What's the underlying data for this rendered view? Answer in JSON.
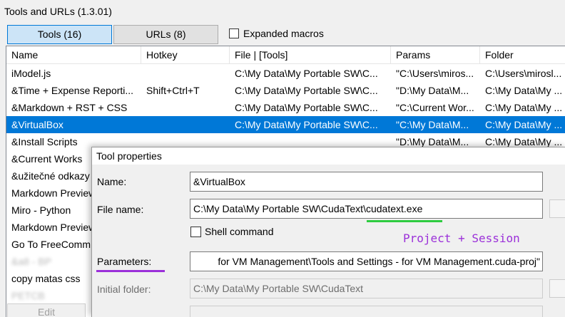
{
  "window": {
    "title": "Tools and URLs (1.3.01)"
  },
  "tabs": [
    {
      "label": "Tools (16)",
      "active": true
    },
    {
      "label": "URLs (8)",
      "active": false
    }
  ],
  "expanded_macros": {
    "label": "Expanded macros",
    "checked": false
  },
  "list": {
    "columns": [
      "Name",
      "Hotkey",
      "File | [Tools]",
      "Params",
      "Folder"
    ],
    "rows": [
      {
        "name": "iModel.js",
        "hotkey": "",
        "file": "C:\\My Data\\My Portable SW\\C...",
        "params": "\"C:\\Users\\miros...",
        "folder": "C:\\Users\\mirosl..."
      },
      {
        "name": "&Time + Expense Reporti...",
        "hotkey": "Shift+Ctrl+T",
        "file": "C:\\My Data\\My Portable SW\\C...",
        "params": "\"D:\\My Data\\M...",
        "folder": "C:\\My Data\\My ..."
      },
      {
        "name": "&Markdown + RST + CSS",
        "hotkey": "",
        "file": "C:\\My Data\\My Portable SW\\C...",
        "params": "\"C:\\Current Wor...",
        "folder": "C:\\My Data\\My ..."
      },
      {
        "name": "&VirtualBox",
        "hotkey": "",
        "file": "C:\\My Data\\My Portable SW\\C...",
        "params": "\"C:\\My Data\\M...",
        "folder": "C:\\My Data\\My ..."
      },
      {
        "name": "&Install Scripts",
        "hotkey": "",
        "file": "",
        "params": "\"D:\\My Data\\M...",
        "folder": "C:\\My Data\\My ..."
      },
      {
        "name": "&Current Works",
        "hotkey": "",
        "file": "",
        "params": "",
        "folder": ""
      },
      {
        "name": "&užitečné odkazy",
        "hotkey": "",
        "file": "",
        "params": "",
        "folder": ""
      },
      {
        "name": "Markdown Preview",
        "hotkey": "",
        "file": "",
        "params": "",
        "folder": ""
      },
      {
        "name": "Miro - Python",
        "hotkey": "",
        "file": "",
        "params": "",
        "folder": ""
      },
      {
        "name": "Markdown Preview",
        "hotkey": "",
        "file": "",
        "params": "",
        "folder": ""
      },
      {
        "name": "Go To FreeComm...",
        "hotkey": "",
        "file": "",
        "params": "",
        "folder": ""
      },
      {
        "name": "&a8 - BP",
        "hotkey": "",
        "file": "",
        "params": "",
        "folder": ""
      },
      {
        "name": "copy matas css",
        "hotkey": "",
        "file": "",
        "params": "",
        "folder": ""
      },
      {
        "name": "PETCB",
        "hotkey": "",
        "file": "",
        "params": "",
        "folder": ""
      }
    ],
    "selected_index": 3
  },
  "edit_button": {
    "label": "Edit"
  },
  "dialog": {
    "title": "Tool properties",
    "name": {
      "label": "Name:",
      "value": "&VirtualBox"
    },
    "file_name": {
      "label": "File name:",
      "value": "C:\\My Data\\My Portable SW\\CudaText\\cudatext.exe"
    },
    "shell_command": {
      "label": "Shell command",
      "checked": false
    },
    "parameters": {
      "label": "Parameters:",
      "value": "for VM Management\\Tools and Settings - for VM Management.cuda-proj\""
    },
    "initial_folder": {
      "label": "Initial folder:",
      "value": "C:\\My Data\\My Portable SW\\CudaText"
    }
  },
  "annotation": {
    "text": "Project + Session",
    "color": "#9b30d9",
    "underline_file_color": "#2ecc40",
    "underline_params_color": "#9b30d9"
  },
  "colors": {
    "selection": "#0078d7",
    "tab_active": "#cce4f7"
  }
}
